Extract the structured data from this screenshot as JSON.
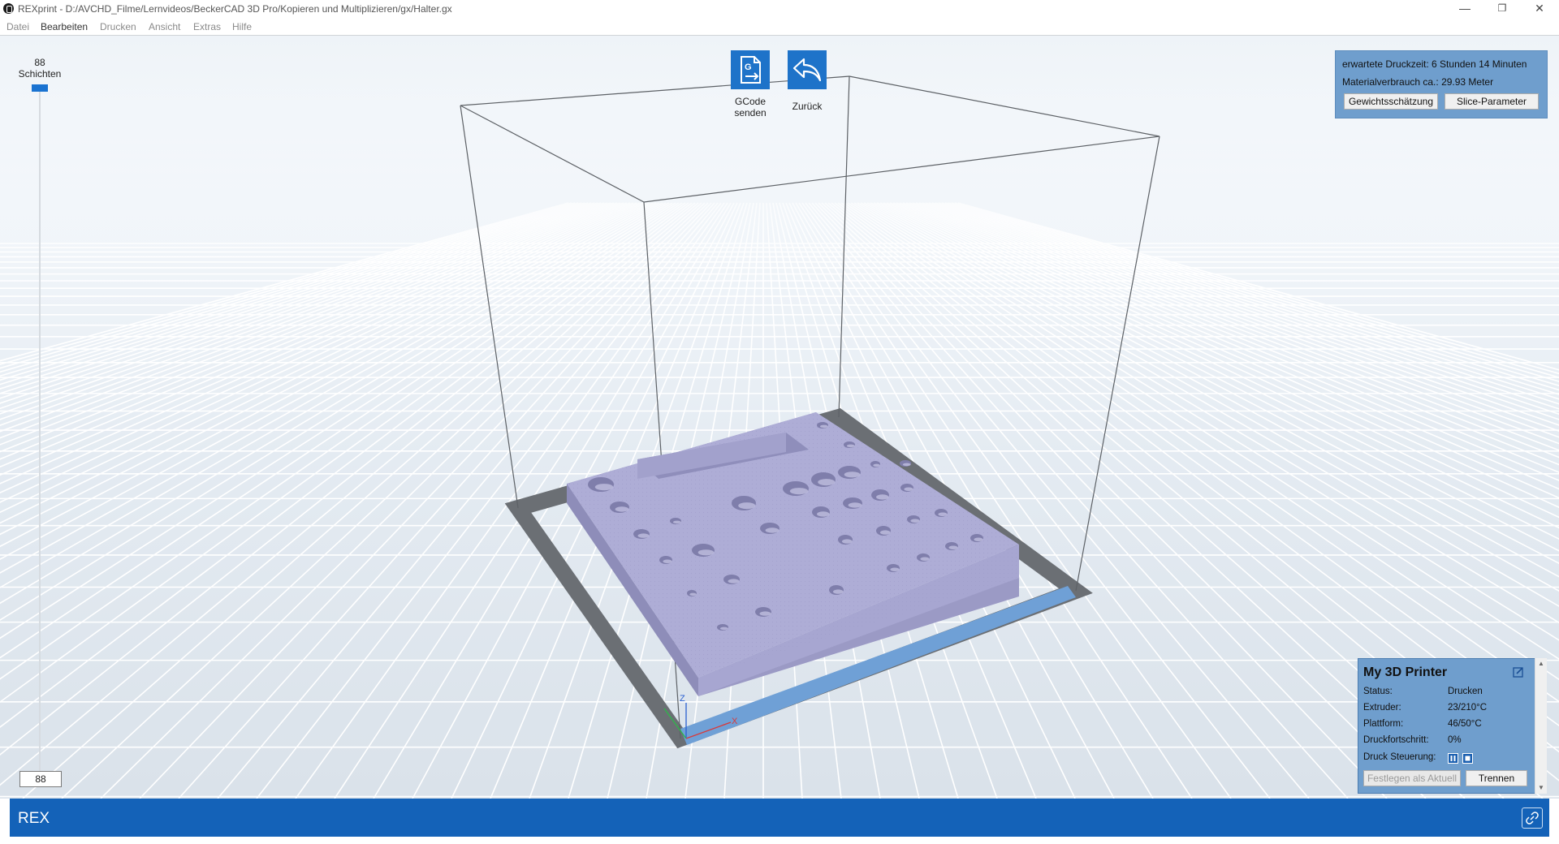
{
  "window": {
    "title": "REXprint - D:/AVCHD_Filme/Lernvideos/BeckerCAD 3D Pro/Kopieren und Multiplizieren/gx/Halter.gx",
    "minimize": "—",
    "restore": "❐",
    "close": "✕"
  },
  "menu": {
    "items": [
      "Datei",
      "Bearbeiten",
      "Drucken",
      "Ansicht",
      "Extras",
      "Hilfe"
    ]
  },
  "layers": {
    "count_label": "88",
    "label": "Schichten",
    "current": "88",
    "slider_level": 1.0
  },
  "toolbar": {
    "gcode_label_line1": "GCode",
    "gcode_label_line2": "senden",
    "gcode_icon_letter": "G",
    "back_label": "Zurück"
  },
  "info": {
    "time_label": "erwartete Druckzeit:",
    "time_value": "6 Stunden 14 Minuten",
    "material_label": "Materialverbrauch ca.:",
    "material_value": "29.93 Meter",
    "weight_button": "Gewichtsschätzung",
    "slice_button": "Slice-Parameter"
  },
  "printer": {
    "name": "My 3D Printer",
    "status_label": "Status:",
    "status_value": "Drucken",
    "extruder_label": "Extruder:",
    "extruder_value": "23/210°C",
    "platform_label": "Plattform:",
    "platform_value": "46/50°C",
    "progress_label": "Druckfortschritt:",
    "progress_value": "0%",
    "control_label": "Druck Steuerung:",
    "set_current_button": "Festlegen als Aktuell",
    "disconnect_button": "Trennen"
  },
  "axes": {
    "x": "X",
    "z": "Z"
  },
  "bottom": {
    "brand": "REX"
  },
  "colors": {
    "accent": "#1e73c9",
    "bottom_bar": "#1462b8",
    "panel": "#6f9ecd",
    "model": "#aeadd6"
  }
}
